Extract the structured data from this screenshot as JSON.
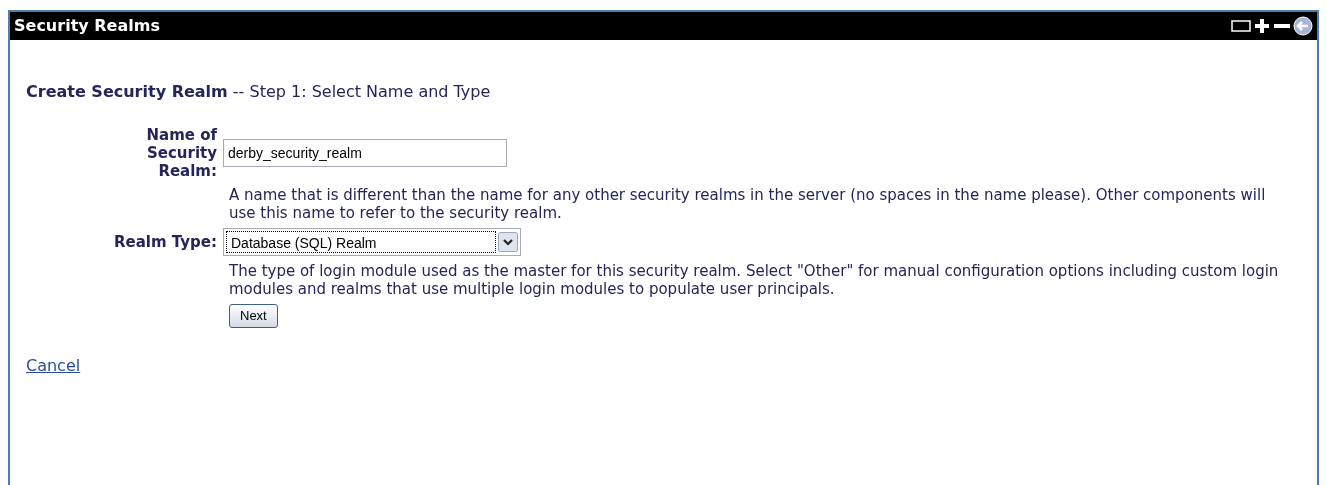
{
  "window": {
    "title": "Security Realms"
  },
  "heading": "**Create Security Realm** -- Step 1: Select Name and Type",
  "fields": [
    {
      "kind": "text",
      "label": "Name of Security Realm:",
      "value": "derby_security_realm",
      "help": "A name that is different than the name for any other security realms in the server (no spaces in the name please). Other components will use this name to refer to the security realm."
    },
    {
      "kind": "select",
      "label": "Realm Type:",
      "value": "Database (SQL) Realm",
      "help": "The type of login module used as the master for this security realm. Select \"Other\" for manual configuration options including custom login modules and realms that use multiple login modules to populate user principals."
    }
  ],
  "next_button": "Next",
  "cancel_link": "Cancel"
}
